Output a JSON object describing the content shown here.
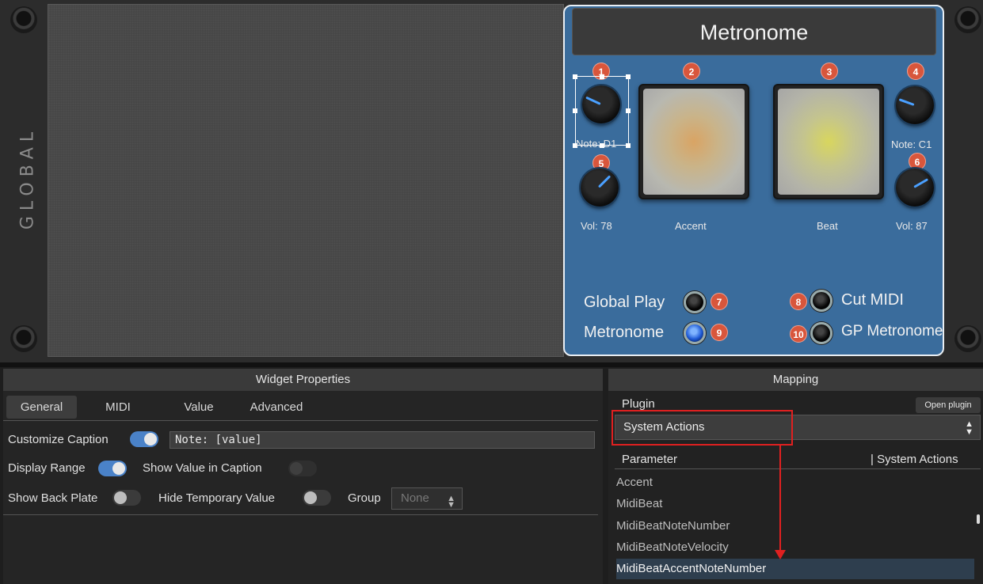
{
  "rack": {
    "global_label": "GLOBAL"
  },
  "panel": {
    "title": "Metronome",
    "badges": [
      "1",
      "2",
      "3",
      "4",
      "5",
      "6",
      "7",
      "8",
      "9",
      "10"
    ],
    "knobs": {
      "accent_note": "Note: D1",
      "beat_note": "Note: C1",
      "accent_vol": "Vol: 78",
      "beat_vol": "Vol: 87"
    },
    "pads": {
      "accent": "Accent",
      "beat": "Beat"
    },
    "leds": {
      "global_play": "Global Play",
      "metronome": "Metronome",
      "cut_midi": "Cut MIDI",
      "gp_metronome": "GP Metronome"
    },
    "colors": {
      "panel_bg": "#3a6c9c",
      "badge": "#d8563c",
      "knob_indicator": "#4aa0ff"
    }
  },
  "widget_properties": {
    "title": "Widget Properties",
    "tabs": [
      "General",
      "MIDI",
      "Value",
      "Advanced"
    ],
    "active_tab": "General",
    "customize_caption": {
      "label": "Customize Caption",
      "on": true,
      "value": "Note: [value]"
    },
    "display_range": {
      "label": "Display Range",
      "on": true
    },
    "show_value_in_caption": {
      "label": "Show Value in Caption",
      "on": false
    },
    "show_back_plate": {
      "label": "Show Back Plate",
      "on": false
    },
    "hide_temporary_value": {
      "label": "Hide Temporary Value",
      "on": false
    },
    "group": {
      "label": "Group",
      "value": "None"
    }
  },
  "mapping": {
    "title": "Mapping",
    "plugin_label": "Plugin",
    "open_plugin_label": "Open plugin",
    "plugin_value": "System Actions",
    "parameter_header": "Parameter",
    "parameter_header_right": "| System Actions",
    "parameters": [
      "Accent",
      "MidiBeat",
      "MidiBeatNoteNumber",
      "MidiBeatNoteVelocity",
      "MidiBeatAccentNoteNumber"
    ],
    "selected_parameter": "MidiBeatAccentNoteNumber"
  }
}
